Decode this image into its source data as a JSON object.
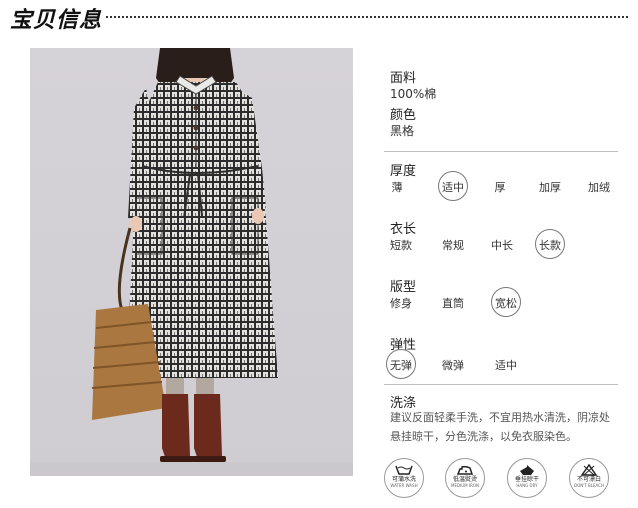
{
  "header": {
    "title": "宝贝信息"
  },
  "material": {
    "label": "面料",
    "value": "100%棉"
  },
  "color": {
    "label": "颜色",
    "value": "黑格"
  },
  "thickness": {
    "label": "厚度",
    "options": [
      "薄",
      "适中",
      "厚",
      "加厚",
      "加绒"
    ],
    "selected": "适中"
  },
  "length": {
    "label": "衣长",
    "options": [
      "短款",
      "常规",
      "中长",
      "长款"
    ],
    "selected": "长款"
  },
  "fit": {
    "label": "版型",
    "options": [
      "修身",
      "直筒",
      "宽松"
    ],
    "selected": "宽松"
  },
  "elasticity": {
    "label": "弹性",
    "options": [
      "无弹",
      "微弹",
      "适中"
    ],
    "selected": "无弹"
  },
  "care": {
    "label": "洗涤",
    "line1": "建议反面轻柔手洗，不宜用热水清洗，阴凉处",
    "line2": "悬挂晾干，分色洗涤，以免衣服染色。",
    "icons": [
      {
        "icon": "washtub-icon",
        "zh": "可蒲水洗",
        "en": "WATER WASH"
      },
      {
        "icon": "iron-icon",
        "zh": "低温熨烫",
        "en": "MEDIUM IRON"
      },
      {
        "icon": "hanging-dry-icon",
        "zh": "垂挂晾干",
        "en": "HANG DRY"
      },
      {
        "icon": "no-bleach-icon",
        "zh": "不可漂白",
        "en": "DON'T BLEACH"
      }
    ]
  },
  "colors": {
    "divider": "#bfbfbf",
    "circle": "#777777",
    "photo_bg": "#d3d1d6"
  }
}
